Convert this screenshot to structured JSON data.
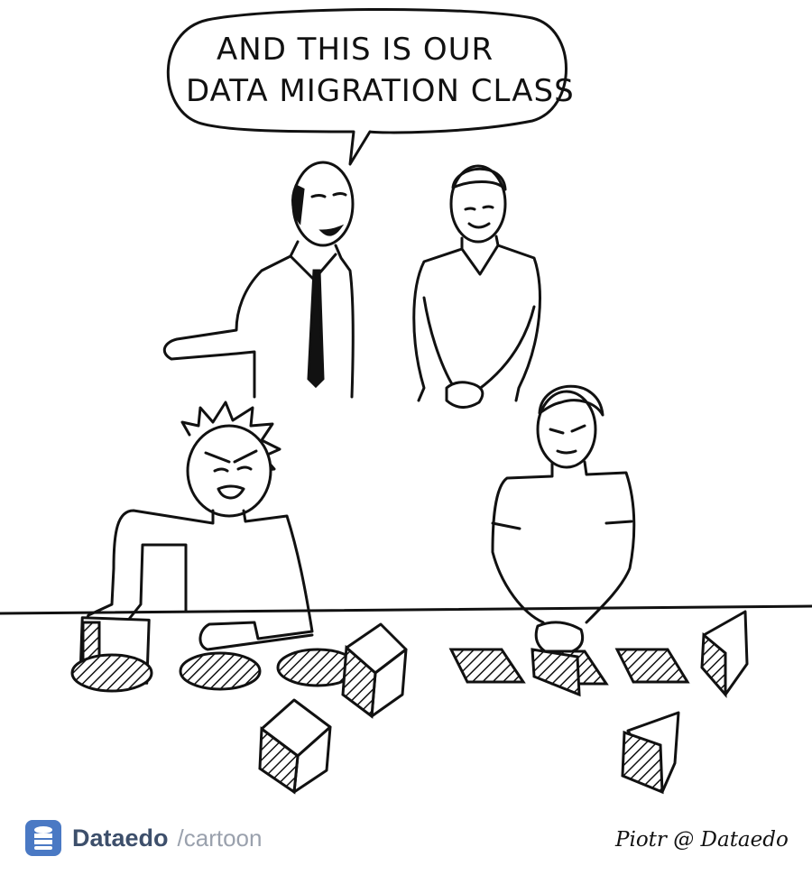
{
  "speech_bubble": {
    "line1": "AND THIS IS OUR",
    "line2": "DATA MIGRATION CLASS"
  },
  "footer": {
    "brand": "Dataedo",
    "section": "/cartoon",
    "signature": "Piotr @ Dataedo"
  },
  "colors": {
    "ink": "#111111",
    "brand": "#3d4f6b",
    "brand_icon": "#4a79c4",
    "muted": "#9aa1ad"
  },
  "icons": [
    "database-icon"
  ]
}
